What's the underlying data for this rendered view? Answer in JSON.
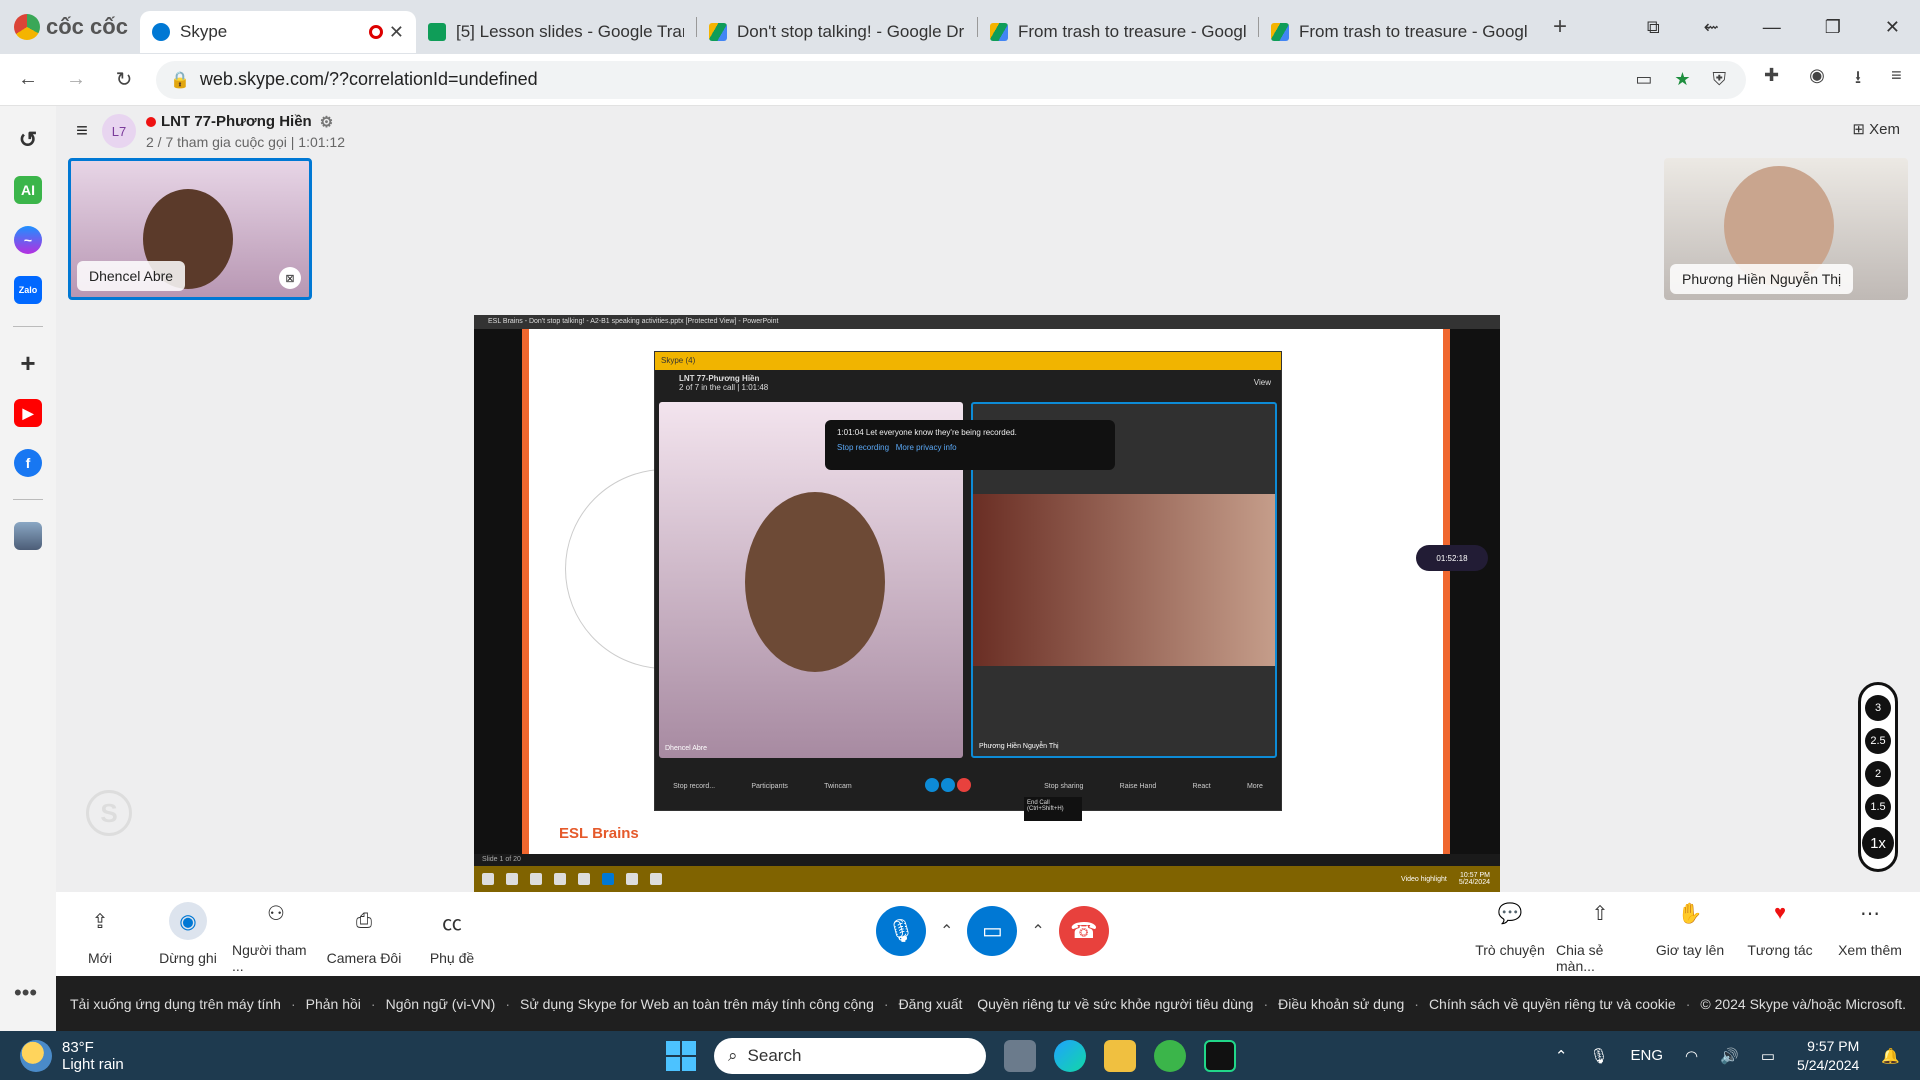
{
  "browser": {
    "brand": "cốc cốc",
    "tabs": [
      {
        "title": "Skype",
        "icon": "skype-icon",
        "active": true
      },
      {
        "title": "[5] Lesson slides - Google Trang",
        "icon": "google-sheets-icon"
      },
      {
        "title": "Don't stop talking! - Google Dri",
        "icon": "google-drive-icon"
      },
      {
        "title": "From trash to treasure - Google",
        "icon": "google-drive-icon"
      },
      {
        "title": "From trash to treasure - Google",
        "icon": "google-drive-icon"
      }
    ],
    "url": "web.skype.com/??correlationId=undefined"
  },
  "call": {
    "avatar": "L7",
    "title": "LNT 77-Phương Hiền",
    "subtitle": "2 / 7 tham gia cuộc gọi | 1:01:12",
    "view_label": "Xem",
    "participants": [
      {
        "name": "Dhencel Abre"
      },
      {
        "name": "Phương Hiền Nguyễn Thị"
      }
    ]
  },
  "share": {
    "ppt_title": "ESL Brains - Don't stop talking! - A2-B1 speaking activities.pptx [Protected View] - PowerPoint",
    "slide_brand": "ESL Brains",
    "inner": {
      "window_title": "Skype (4)",
      "call_title": "LNT 77-Phương Hiền",
      "call_sub": "2 of 7 in the call | 1:01:48",
      "view": "View",
      "record_msg": "1:01:04 Let everyone know they're being recorded.",
      "stop_recording": "Stop recording",
      "more_privacy": "More privacy info",
      "name_a": "Dhencel Abre",
      "name_b": "Phương Hiền Nguyễn Thị",
      "controls": [
        "Stop record...",
        "Participants",
        "Twincam",
        "Stop sharing",
        "Raise Hand",
        "React",
        "More"
      ],
      "tooltip": "End Call (Ctrl+Shift+H)",
      "slide_status": "Slide 1 of 20",
      "video_highlight": "Video highlight",
      "task_time": "10:57 PM",
      "task_date": "5/24/2024",
      "counter": "01:52:18"
    }
  },
  "speed": [
    "3",
    "2.5",
    "2",
    "1.5",
    "1x"
  ],
  "controls": {
    "left": [
      {
        "label": "Mới",
        "icon": "share-upload-icon"
      },
      {
        "label": "Dừng ghi",
        "icon": "record-icon"
      },
      {
        "label": "Người tham ...",
        "icon": "participants-icon"
      },
      {
        "label": "Camera Đôi",
        "icon": "twin-camera-icon"
      },
      {
        "label": "Phụ đề",
        "icon": "captions-icon"
      }
    ],
    "right": [
      {
        "label": "Trò chuyện",
        "icon": "chat-icon"
      },
      {
        "label": "Chia sẻ màn...",
        "icon": "share-screen-icon"
      },
      {
        "label": "Giơ tay lên",
        "icon": "raise-hand-icon"
      },
      {
        "label": "Tương tác",
        "icon": "heart-icon"
      },
      {
        "label": "Xem thêm",
        "icon": "more-icon"
      }
    ]
  },
  "footer": {
    "left": [
      "Tải xuống ứng dụng trên máy tính",
      "Phản hồi",
      "Ngôn ngữ (vi-VN)",
      "Sử dụng Skype for Web an toàn trên máy tính công cộng",
      "Đăng xuất"
    ],
    "right": [
      "Quyền riêng tư về sức khỏe người tiêu dùng",
      "Điều khoản sử dụng",
      "Chính sách về quyền riêng tư và cookie",
      "© 2024 Skype và/hoặc Microsoft."
    ]
  },
  "taskbar": {
    "temp": "83°F",
    "weather": "Light rain",
    "weather_badge": "1",
    "search": "Search",
    "lang": "ENG",
    "time": "9:57 PM",
    "date": "5/24/2024"
  },
  "colors": {
    "accent": "#0078d4",
    "end_call": "#e8413d",
    "taskbar": "#1e3a4f"
  }
}
